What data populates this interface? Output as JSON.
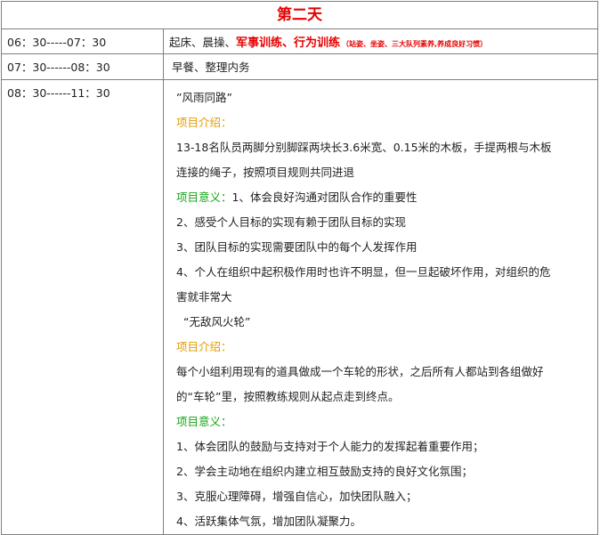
{
  "day_title": "第二天",
  "rows": [
    {
      "time": "06：30-----07：30",
      "activity_plain": "起床、晨操、",
      "activity_bold": "军事训练、行为训练",
      "activity_small": "（站姿、坐姿、三大队列素养,养成良好习惯）"
    },
    {
      "time": "07：30------08：30",
      "activity_plain": "早餐、整理内务"
    },
    {
      "time": "08：30------11：30",
      "lines": [
        {
          "text": "”风雨同路”",
          "color": "default"
        },
        {
          "text": "项目介绍：",
          "color": "orange"
        },
        {
          "text": "13-18名队员两脚分别脚踩两块长3.6米宽、0.15米的木板，手提两根与木板",
          "color": "default"
        },
        {
          "text": "连接的绳子，按照项目规则共同进退",
          "color": "default"
        },
        {
          "label": "项目意义：",
          "text": "1、体会良好沟通对团队合作的重要性",
          "color": "green-label"
        },
        {
          "text": "2、感受个人目标的实现有赖于团队目标的实现",
          "color": "default"
        },
        {
          "text": "3、团队目标的实现需要团队中的每个人发挥作用",
          "color": "default"
        },
        {
          "text": "4、个人在组织中起积极作用时也许不明显，但一旦起破坏作用，对组织的危",
          "color": "default"
        },
        {
          "text": "害就非常大",
          "color": "default"
        },
        {
          "text": "“无敌风火轮”",
          "color": "default",
          "indent": true
        },
        {
          "text": "项目介绍：",
          "color": "orange"
        },
        {
          "text": "每个小组利用现有的道具做成一个车轮的形状，之后所有人都站到各组做好",
          "color": "default"
        },
        {
          "text": "的“车轮”里，按照教练规则从起点走到终点。",
          "color": "default"
        },
        {
          "text": "项目意义：",
          "color": "green"
        },
        {
          "text": "1、体会团队的鼓励与支持对于个人能力的发挥起着重要作用；",
          "color": "default"
        },
        {
          "text": "2、学会主动地在组织内建立相互鼓励支持的良好文化氛围；",
          "color": "default"
        },
        {
          "text": "3、克服心理障碍，增强自信心，加快团队融入；",
          "color": "default"
        },
        {
          "text": "4、活跃集体气氛，增加团队凝聚力。",
          "color": "default"
        }
      ]
    }
  ]
}
